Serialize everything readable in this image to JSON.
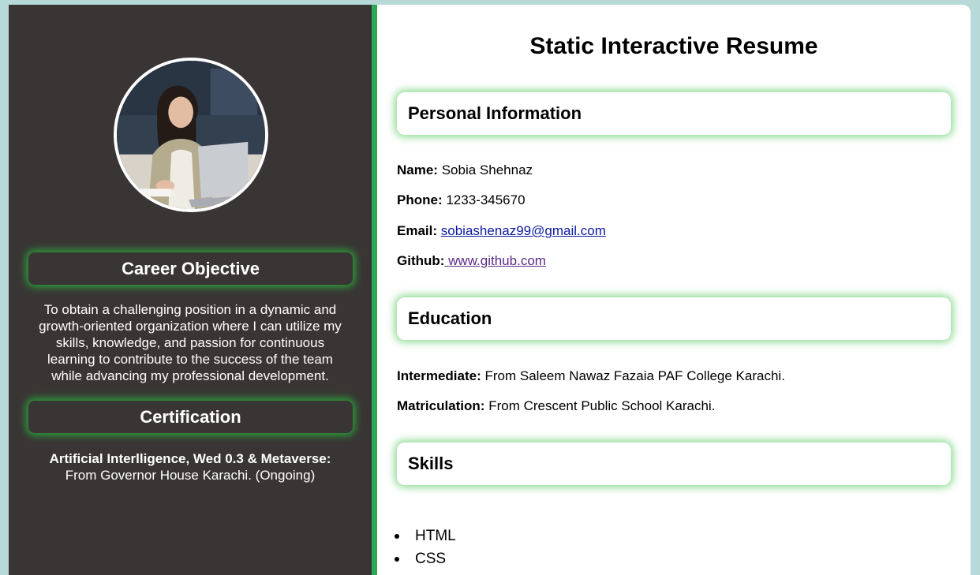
{
  "left_panel": {
    "career_objective": {
      "heading": "Career Objective",
      "text": "To obtain a challenging position in a dynamic and growth-oriented organization where I can utilize my skills, knowledge, and passion for continuous learning to contribute to the success of the team while advancing my professional development."
    },
    "certification": {
      "heading": "Certification",
      "title": "Artificial Interlligence, Wed 0.3 & Metaverse:",
      "detail": "From Governor House Karachi. (Ongoing)"
    }
  },
  "main": {
    "title": "Static Interactive Resume",
    "personal_information": {
      "heading": "Personal Information",
      "name_label": "Name:",
      "name_value": "Sobia Shehnaz",
      "phone_label": "Phone:",
      "phone_value": "1233-345670",
      "email_label": "Email:",
      "email_value": "sobiashenaz99@gmail.com",
      "github_label": "Github:",
      "github_value": "www.github.com"
    },
    "education": {
      "heading": "Education",
      "intermediate_label": "Intermediate:",
      "intermediate_value": "From Saleem Nawaz Fazaia PAF College Karachi.",
      "matriculation_label": "Matriculation:",
      "matriculation_value": "From Crescent Public School Karachi."
    },
    "skills": {
      "heading": "Skills",
      "items": [
        "HTML",
        "CSS"
      ]
    }
  },
  "colors": {
    "page_background": "#b7d9d7",
    "sidebar_background": "#393534",
    "accent_green": "#2bab55",
    "heading_glow": "#32be3c",
    "link_color": "#0b1b9e",
    "visited_link_color": "#5b2a86"
  }
}
